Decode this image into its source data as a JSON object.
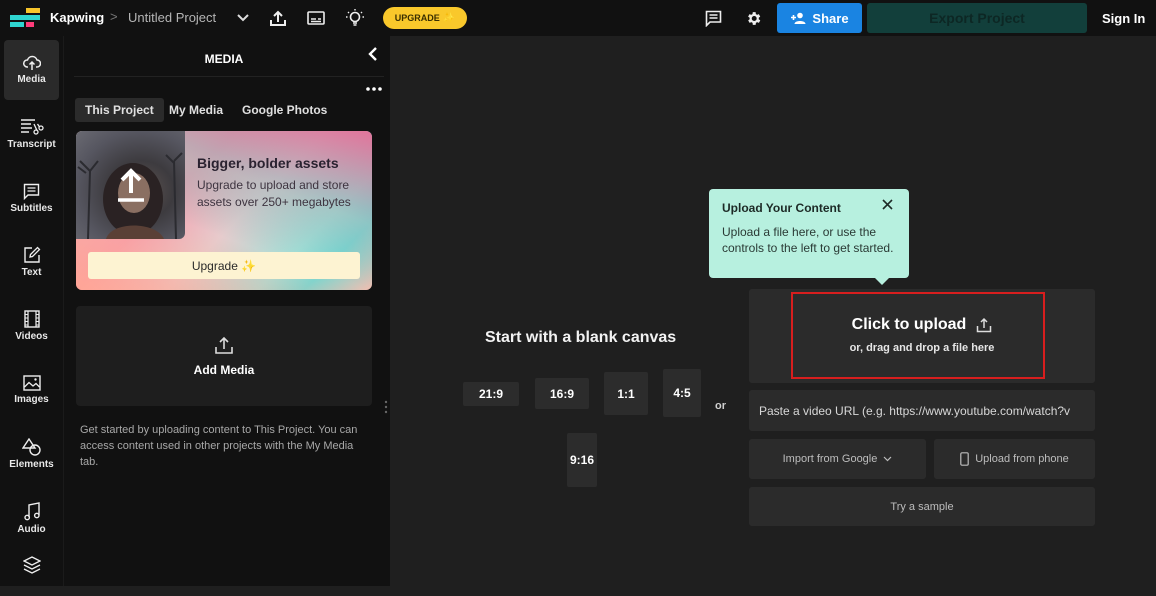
{
  "header": {
    "brand": "Kapwing",
    "breadcrumb_sep": ">",
    "project_title": "Untitled Project",
    "upgrade_label": "UPGRADE",
    "share_label": "Share",
    "export_label": "Export Project",
    "signin_label": "Sign In",
    "icons": [
      "kapwing-logo-icon",
      "chevron-down-icon",
      "upload-icon",
      "subtitles-icon",
      "lightbulb-icon",
      "sparkle-icon",
      "comment-icon",
      "gear-icon",
      "add-person-icon"
    ],
    "colors": {
      "upgrade": "#f9c82b",
      "share": "#1a84e2",
      "export": "#123f3b"
    }
  },
  "sidebar": {
    "items": [
      {
        "label": "Media",
        "icon": "cloud-upload-icon",
        "active": true
      },
      {
        "label": "Transcript",
        "icon": "transcript-scissors-icon",
        "active": false
      },
      {
        "label": "Subtitles",
        "icon": "subtitles-icon",
        "active": false
      },
      {
        "label": "Text",
        "icon": "edit-text-icon",
        "active": false
      },
      {
        "label": "Videos",
        "icon": "film-icon",
        "active": false
      },
      {
        "label": "Images",
        "icon": "image-icon",
        "active": false
      },
      {
        "label": "Elements",
        "icon": "shapes-icon",
        "active": false
      },
      {
        "label": "Audio",
        "icon": "music-note-icon",
        "active": false
      },
      {
        "label": "",
        "icon": "layers-icon",
        "active": false
      }
    ]
  },
  "media_panel": {
    "title": "MEDIA",
    "tabs": [
      {
        "label": "This Project",
        "active": true
      },
      {
        "label": "My Media",
        "active": false
      },
      {
        "label": "Google Photos",
        "active": false
      }
    ],
    "promo": {
      "title": "Bigger, bolder assets",
      "text": "Upgrade to upload and store assets over 250+ megabytes",
      "button": "Upgrade ✨"
    },
    "add_media_label": "Add Media",
    "help_text": "Get started by uploading content to This Project. You can access content used in other projects with the My Media tab."
  },
  "canvas": {
    "blank_title": "Start with a blank canvas",
    "ratios": [
      "21:9",
      "16:9",
      "1:1",
      "4:5",
      "9:16"
    ],
    "or_label": "or"
  },
  "tooltip": {
    "title": "Upload Your Content",
    "text": "Upload a file here, or use the controls to the left to get started."
  },
  "upload": {
    "title": "Click to upload",
    "subtitle": "or, drag and drop a file here",
    "url_placeholder": "Paste a video URL (e.g. https://www.youtube.com/watch?v",
    "import_google": "Import from Google",
    "upload_phone": "Upload from phone",
    "try_sample": "Try a sample",
    "highlight_color": "#d81e1e"
  }
}
